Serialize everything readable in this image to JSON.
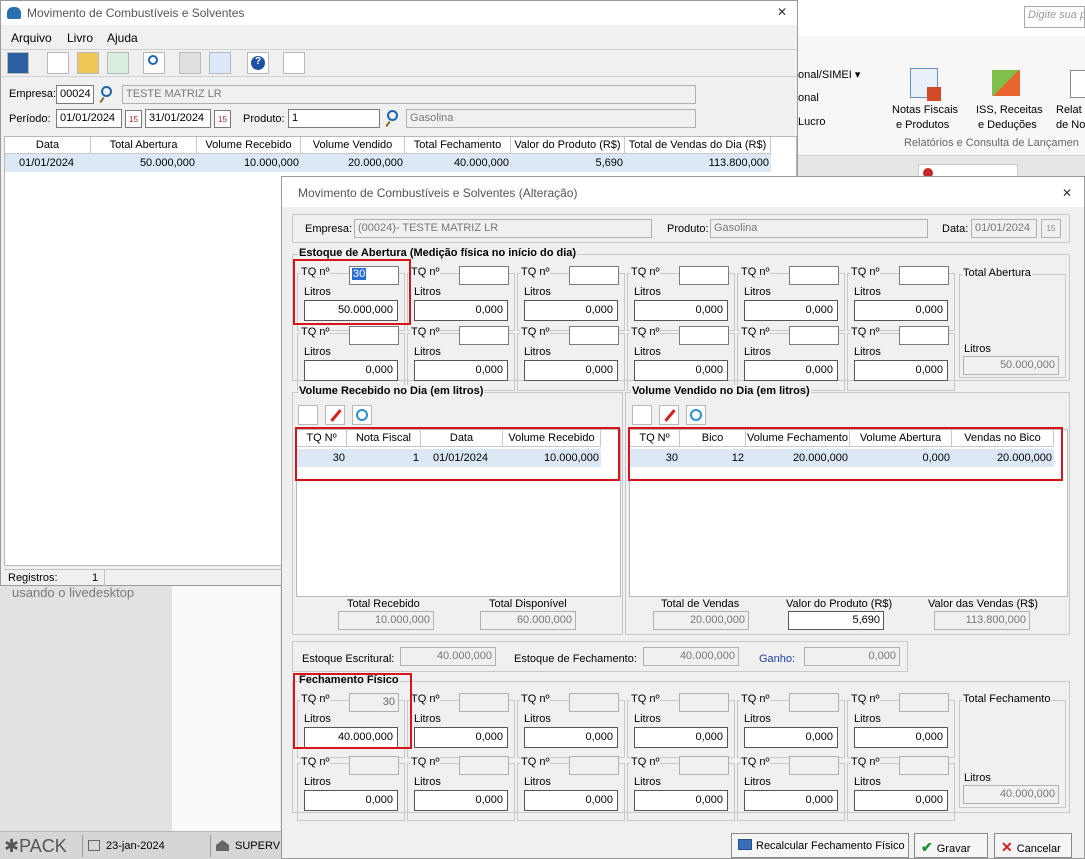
{
  "bg_app": {
    "search_placeholder": "Digite sua p",
    "ribbon_left": [
      "onal/SIMEI",
      "onal",
      "Lucro"
    ],
    "ribbon_btn1_l1": "Notas Fiscais",
    "ribbon_btn1_l2": "e Produtos",
    "ribbon_btn2_l1": "ISS, Receitas",
    "ribbon_btn2_l2": "e Deduções",
    "ribbon_btn3_l1": "Relat",
    "ribbon_btn3_l2": "de No",
    "ribbon_group": "Relatórios e Consulta de Lançamen",
    "livedesktop": "usando o livedesktop"
  },
  "taskbar": {
    "logo": "PACK",
    "date": "23-jan-2024",
    "app": "SUPERV"
  },
  "main": {
    "title": "Movimento de Combustíveis e Solventes",
    "menu": [
      "Arquivo",
      "Livro",
      "Ajuda"
    ],
    "empresa_label": "Empresa:",
    "empresa_code": "00024",
    "empresa_name": "TESTE MATRIZ LR",
    "periodo_label": "Período:",
    "date_from": "01/01/2024",
    "date_to": "31/01/2024",
    "produto_label": "Produto:",
    "produto_code": "1",
    "produto_name": "Gasolina",
    "columns": [
      "Data",
      "Total Abertura",
      "Volume Recebido",
      "Volume Vendido",
      "Total Fechamento",
      "Valor do Produto (R$)",
      "Total de Vendas do Dia (R$)"
    ],
    "row": [
      "01/01/2024",
      "50.000,000",
      "10.000,000",
      "20.000,000",
      "40.000,000",
      "5,690",
      "113.800,000"
    ],
    "registros_label": "Registros:",
    "registros_value": "1"
  },
  "dialog": {
    "title": "Movimento de Combustíveis e Solventes (Alteração)",
    "empresa_label": "Empresa:",
    "empresa_value": "(00024)- TESTE MATRIZ LR",
    "produto_label": "Produto:",
    "produto_value": "Gasolina",
    "data_label": "Data:",
    "data_value": "01/01/2024",
    "cal_day": "15",
    "tq_label": "TQ nº",
    "litros_label": "Litros",
    "abertura": {
      "title": "Estoque de Abertura (Medição física no início do dia)",
      "tq1": "30",
      "val1": "50.000,000",
      "zero": "0,000",
      "total_title": "Total Abertura",
      "total_litros": "Litros",
      "total_value": "50.000,000"
    },
    "recebido": {
      "title": "Volume Recebido no Dia (em litros)",
      "columns": [
        "TQ Nº",
        "Nota Fiscal",
        "Data",
        "Volume Recebido"
      ],
      "row": [
        "30",
        "1",
        "01/01/2024",
        "10.000,000"
      ],
      "total_recebido_label": "Total Recebido",
      "total_recebido": "10.000,000",
      "total_disponivel_label": "Total Disponível",
      "total_disponivel": "60.000,000"
    },
    "vendido": {
      "title": "Volume Vendido no Dia (em litros)",
      "columns": [
        "TQ Nº",
        "Bico",
        "Volume Fechamento",
        "Volume Abertura",
        "Vendas no Bico"
      ],
      "row": [
        "30",
        "12",
        "20.000,000",
        "0,000",
        "20.000,000"
      ],
      "total_vendas_label": "Total de Vendas",
      "total_vendas": "20.000,000",
      "valor_produto_label": "Valor do Produto (R$)",
      "valor_produto": "5,690",
      "valor_vendas_label": "Valor das Vendas (R$)",
      "valor_vendas": "113.800,000"
    },
    "estoque_escritural_label": "Estoque Escritural:",
    "estoque_escritural": "40.000,000",
    "estoque_fechamento_label": "Estoque de Fechamento:",
    "estoque_fechamento": "40.000,000",
    "ganho_label": "Ganho:",
    "ganho": "0,000",
    "fechamento": {
      "title": "Fechamento Físico",
      "tq1": "30",
      "val1": "40.000,000",
      "zero": "0,000",
      "total_title": "Total Fechamento",
      "total_litros": "Litros",
      "total_value": "40.000,000"
    },
    "btn_recalcular": "Recalcular Fechamento Físico",
    "btn_gravar": "Gravar",
    "btn_cancelar": "Cancelar"
  }
}
